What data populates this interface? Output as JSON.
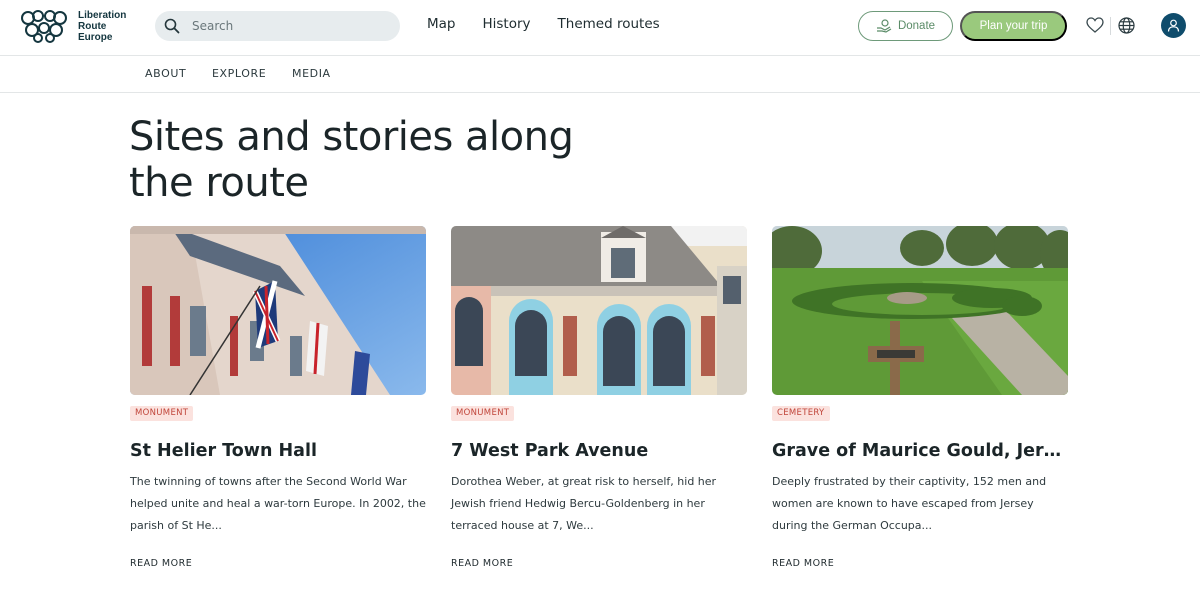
{
  "brand": {
    "line1": "Liberation",
    "line2": "Route",
    "line3": "Europe"
  },
  "search": {
    "placeholder": "Search",
    "value": ""
  },
  "mainnav": [
    "Map",
    "History",
    "Themed routes"
  ],
  "actions": {
    "donate": "Donate",
    "plan": "Plan your trip"
  },
  "subnav": [
    "ABOUT",
    "EXPLORE",
    "MEDIA"
  ],
  "page_title": "Sites and stories along the route",
  "cards": [
    {
      "category": "MONUMENT",
      "title": "St Helier Town Hall",
      "description": "The twinning of towns after the Second World War helped unite and heal a war-torn Europe. In 2002, the parish of St He...",
      "read_more": "READ MORE"
    },
    {
      "category": "MONUMENT",
      "title": "7 West Park Avenue",
      "description": "Dorothea Weber, at great risk to herself, hid her Jewish friend Hedwig Bercu-Goldenberg in her terraced house at 7, We...",
      "read_more": "READ MORE"
    },
    {
      "category": "CEMETERY",
      "title": "Grave of Maurice Gould, Jersey...",
      "description": "Deeply frustrated by their captivity, 152 men and women are known to have escaped from Jersey during the German Occupa...",
      "read_more": "READ MORE"
    }
  ],
  "colors": {
    "accent_green": "#9ac97d",
    "donate_border": "#6e9a7a",
    "avatar": "#0f4c6c",
    "badge_bg": "#fbe2de",
    "badge_text": "#c0453a"
  },
  "icons": [
    "logo-mark",
    "search-icon",
    "donate-hand-icon",
    "heart-icon",
    "globe-icon",
    "user-icon"
  ]
}
